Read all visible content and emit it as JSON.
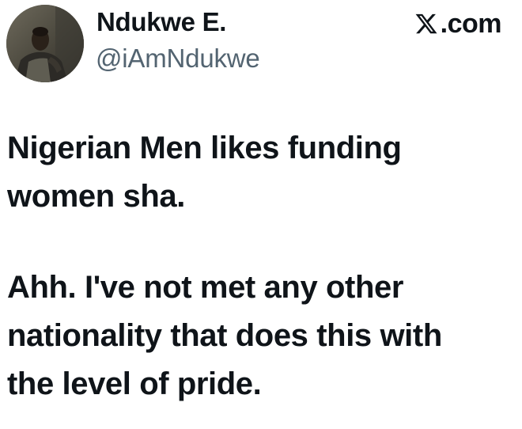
{
  "author": {
    "name": "Ndukwe E.",
    "handle": "@iAmNdukwe",
    "avatar_alt": "profile-photo"
  },
  "brand": {
    "icon": "x-logo-icon",
    "label": ".com"
  },
  "tweet": {
    "paragraphs": [
      {
        "lines": [
          "Nigerian Men likes funding",
          "women sha."
        ]
      },
      {
        "lines": [
          "Ahh. I've not met any other",
          "nationality that does this with",
          "the level of pride."
        ]
      }
    ]
  },
  "colors": {
    "text": "#0f1419",
    "handle": "#536471",
    "background": "#ffffff"
  }
}
